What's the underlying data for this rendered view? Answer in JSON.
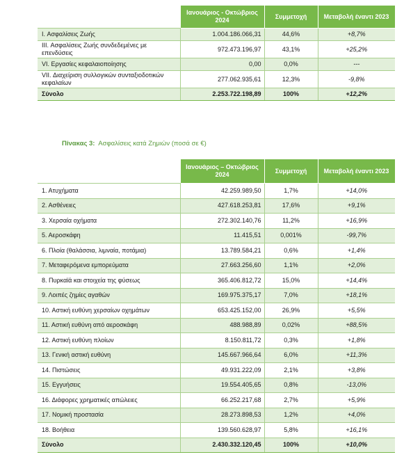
{
  "table1": {
    "headers": [
      "Ιανουάριος - Οκτώβριος 2024",
      "Συμμετοχή",
      "Μεταβολή έναντι 2023"
    ],
    "rows": [
      {
        "label": "I.    Ασφαλίσεις Ζωής",
        "amount": "1.004.186.066,31",
        "share": "44,6%",
        "change": "+8,7%"
      },
      {
        "label": "III.  Ασφαλίσεις Ζωής συνδεδεμένες με επενδύσεις",
        "amount": "972.473.196,97",
        "share": "43,1%",
        "change": "+25,2%"
      },
      {
        "label": "VI.  Εργασίες κεφαλαιοποίησης",
        "amount": "0,00",
        "share": "0,0%",
        "change": "---"
      },
      {
        "label": "VII. Διαχείριση συλλογικών συνταξιοδοτικών κεφαλαίων",
        "amount": "277.062.935,61",
        "share": "12,3%",
        "change": "-9,8%"
      }
    ],
    "total": {
      "label": "Σύνολο",
      "amount": "2.253.722.198,89",
      "share": "100%",
      "change": "+12,2%"
    }
  },
  "caption": {
    "prefix": "Πίνακας 3:",
    "text": "Ασφαλίσεις κατά Ζημιών (ποσά σε €)"
  },
  "table2": {
    "headers": [
      "Ιανουάριος – Οκτώβριος 2024",
      "Συμμετοχή",
      "Μεταβολή έναντι 2023"
    ],
    "rows": [
      {
        "label": "1.   Ατυχήματα",
        "amount": "42.259.989,50",
        "share": "1,7%",
        "change": "+14,0%"
      },
      {
        "label": "2.   Ασθένειες",
        "amount": "427.618.253,81",
        "share": "17,6%",
        "change": "+9,1%"
      },
      {
        "label": "3.   Χερσαία οχήματα",
        "amount": "272.302.140,76",
        "share": "11,2%",
        "change": "+16,9%"
      },
      {
        "label": "5.   Αεροσκάφη",
        "amount": "11.415,51",
        "share": "0,001%",
        "change": "-99,7%"
      },
      {
        "label": "6.   Πλοία (θαλάσσια, λιμναία, ποτάμια)",
        "amount": "13.789.584,21",
        "share": "0,6%",
        "change": "+1,4%"
      },
      {
        "label": "7.   Μεταφερόμενα εμπορεύματα",
        "amount": "27.663.256,60",
        "share": "1,1%",
        "change": "+2,0%"
      },
      {
        "label": "8.   Πυρκαϊά και στοιχεία της φύσεως",
        "amount": "365.406.812,72",
        "share": "15,0%",
        "change": "+14,4%"
      },
      {
        "label": "9.   Λοιπές ζημίες αγαθών",
        "amount": "169.975.375,17",
        "share": "7,0%",
        "change": "+18,1%"
      },
      {
        "label": "10. Αστική ευθύνη χερσαίων οχημάτων",
        "amount": "653.425.152,00",
        "share": "26,9%",
        "change": "+5,5%"
      },
      {
        "label": "11. Αστική ευθύνη από αεροσκάφη",
        "amount": "488.988,89",
        "share": "0,02%",
        "change": "+88,5%"
      },
      {
        "label": "12. Αστική ευθύνη πλοίων",
        "amount": "8.150.811,72",
        "share": "0,3%",
        "change": "+1,8%"
      },
      {
        "label": "13. Γενική αστική ευθύνη",
        "amount": "145.667.966,64",
        "share": "6,0%",
        "change": "+11,3%"
      },
      {
        "label": "14. Πιστώσεις",
        "amount": "49.931.222,09",
        "share": "2,1%",
        "change": "+3,8%"
      },
      {
        "label": "15. Εγγυήσεις",
        "amount": "19.554.405,65",
        "share": "0,8%",
        "change": "-13,0%"
      },
      {
        "label": "16. Διάφορες χρηματικές απώλειες",
        "amount": "66.252.217,68",
        "share": "2,7%",
        "change": "+5,9%"
      },
      {
        "label": "17. Νομική προστασία",
        "amount": "28.273.898,53",
        "share": "1,2%",
        "change": "+4,0%"
      },
      {
        "label": "18. Βοήθεια",
        "amount": "139.560.628,97",
        "share": "5,8%",
        "change": "+16,1%"
      }
    ],
    "total": {
      "label": "Σύνολο",
      "amount": "2.430.332.120,45",
      "share": "100%",
      "change": "+10,0%"
    }
  }
}
